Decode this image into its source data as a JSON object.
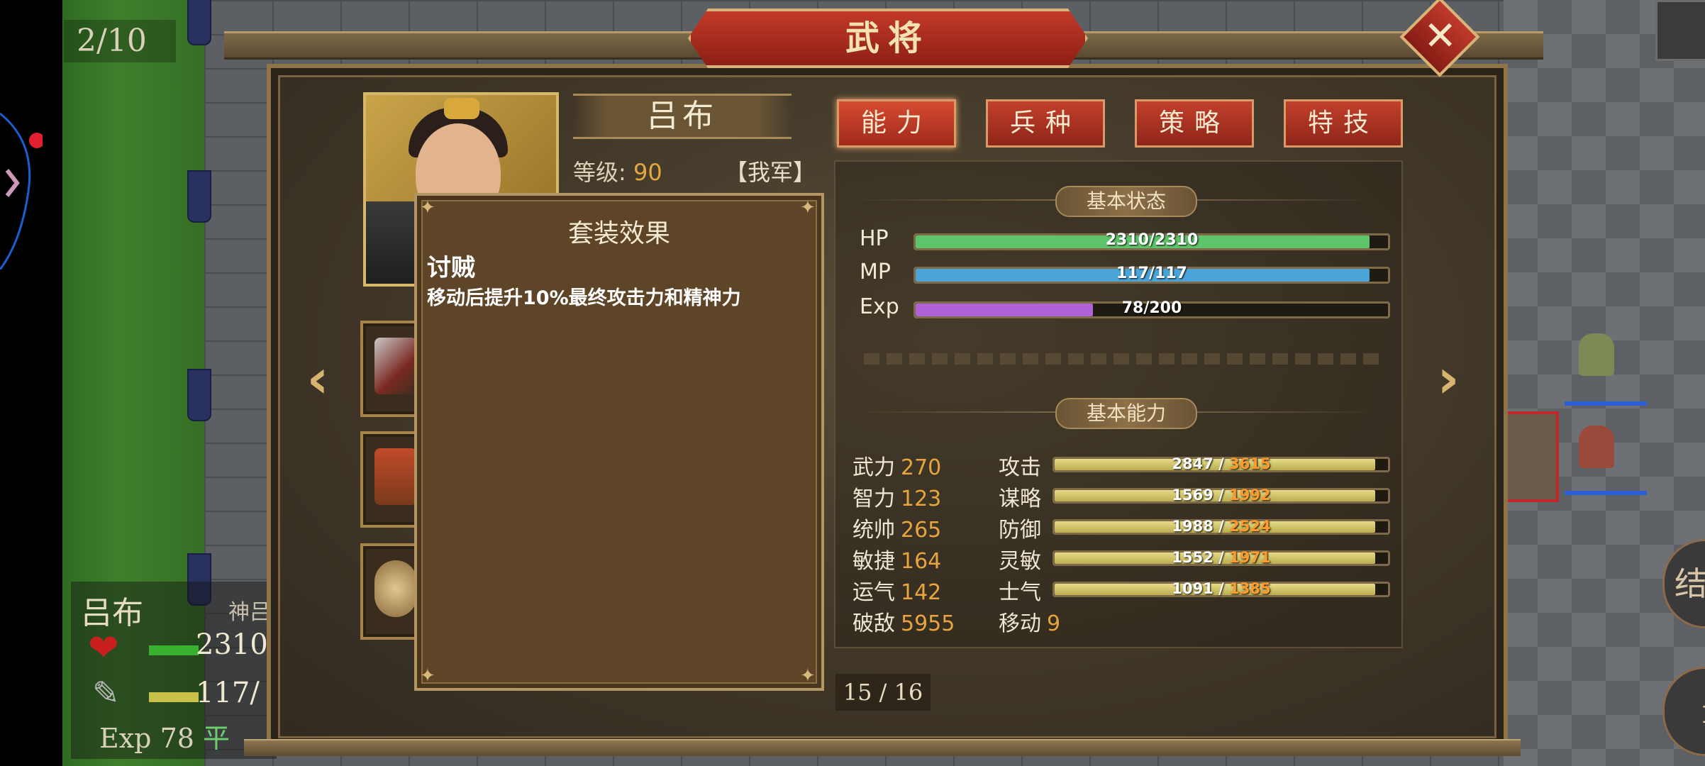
{
  "battlefield": {
    "turn": "2/10",
    "unit": {
      "name": "吕布",
      "class": "神吕",
      "hp": "2310",
      "mp": "117/",
      "exp": "Exp 78",
      "terrain": "平"
    },
    "right_button_1": "结回",
    "right_button_2": "i"
  },
  "header": {
    "title": "武将",
    "close_icon": "close-icon"
  },
  "general": {
    "name": "吕布",
    "level_label": "等级:",
    "level_value": "90",
    "faction": "【我军】"
  },
  "tabs": [
    {
      "label": "能力",
      "active": true
    },
    {
      "label": "兵种",
      "active": false
    },
    {
      "label": "策略",
      "active": false
    },
    {
      "label": "特技",
      "active": false
    }
  ],
  "popup": {
    "title": "套装效果",
    "effect_name": "讨贼",
    "effect_desc": "移动后提升10%最终攻击力和精神力"
  },
  "basic_status": {
    "heading": "基本状态",
    "bars": [
      {
        "label": "HP",
        "text": "2310/2310",
        "fraction": 1.0,
        "color": "#5ec46a"
      },
      {
        "label": "MP",
        "text": "117/117",
        "fraction": 1.0,
        "color": "#4aa4d8"
      },
      {
        "label": "Exp",
        "text": "78/200",
        "fraction": 0.39,
        "color": "#b061d6"
      }
    ]
  },
  "basic_ability": {
    "heading": "基本能力",
    "attributes": [
      {
        "label": "武力",
        "value": "270"
      },
      {
        "label": "智力",
        "value": "123"
      },
      {
        "label": "统帅",
        "value": "265"
      },
      {
        "label": "敏捷",
        "value": "164"
      },
      {
        "label": "运气",
        "value": "142"
      },
      {
        "label": "破敌",
        "value": "5955"
      }
    ],
    "combat": [
      {
        "label": "攻击",
        "base": "2847",
        "max": "3615",
        "fraction": 1.0
      },
      {
        "label": "谋略",
        "base": "1569",
        "max": "1992",
        "fraction": 1.0
      },
      {
        "label": "防御",
        "base": "1988",
        "max": "2524",
        "fraction": 1.0
      },
      {
        "label": "灵敏",
        "base": "1552",
        "max": "1971",
        "fraction": 1.0
      },
      {
        "label": "士气",
        "base": "1091",
        "max": "1385",
        "fraction": 1.0
      }
    ],
    "move_label": "移动",
    "move_value": "9"
  },
  "page": {
    "current": "15",
    "total": "16",
    "separator": " / "
  },
  "colors": {
    "accent_red": "#b8321f",
    "gold": "#d6b46e",
    "highlight_orange": "#e8a43d"
  }
}
